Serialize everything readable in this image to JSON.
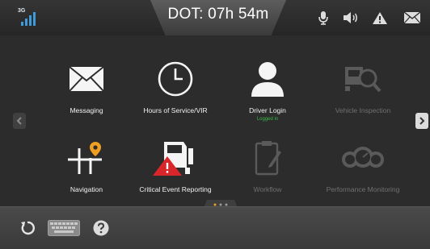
{
  "status_bar": {
    "network_label": "3G",
    "dot_timer": "DOT: 07h 54m",
    "icons": [
      "signal-icon",
      "microphone-icon",
      "speaker-icon",
      "warning-icon",
      "mail-icon"
    ]
  },
  "apps": [
    {
      "label": "Messaging",
      "icon": "envelope-icon",
      "enabled": true
    },
    {
      "label": "Hours of Service/VIR",
      "icon": "clock-icon",
      "enabled": true
    },
    {
      "label": "Driver Login",
      "sublabel": "Logged in",
      "icon": "driver-icon",
      "enabled": true
    },
    {
      "label": "Vehicle Inspection",
      "icon": "inspection-icon",
      "enabled": false
    },
    {
      "label": "Navigation",
      "icon": "navigation-icon",
      "enabled": true
    },
    {
      "label": "Critical Event Reporting",
      "icon": "truck-warning-icon",
      "enabled": true
    },
    {
      "label": "Workflow",
      "icon": "clipboard-icon",
      "enabled": false
    },
    {
      "label": "Performance Monitoring",
      "icon": "gauge-icon",
      "enabled": false
    }
  ],
  "pager": {
    "pages": 3,
    "current": 1
  },
  "bottom_bar": {
    "icons": [
      "refresh-icon",
      "keyboard-icon",
      "help-icon"
    ]
  },
  "colors": {
    "accent_blue": "#3f9ad9",
    "logged_in_green": "#3fb84a",
    "warning_red": "#d9262b",
    "pin_orange": "#f0a020"
  }
}
